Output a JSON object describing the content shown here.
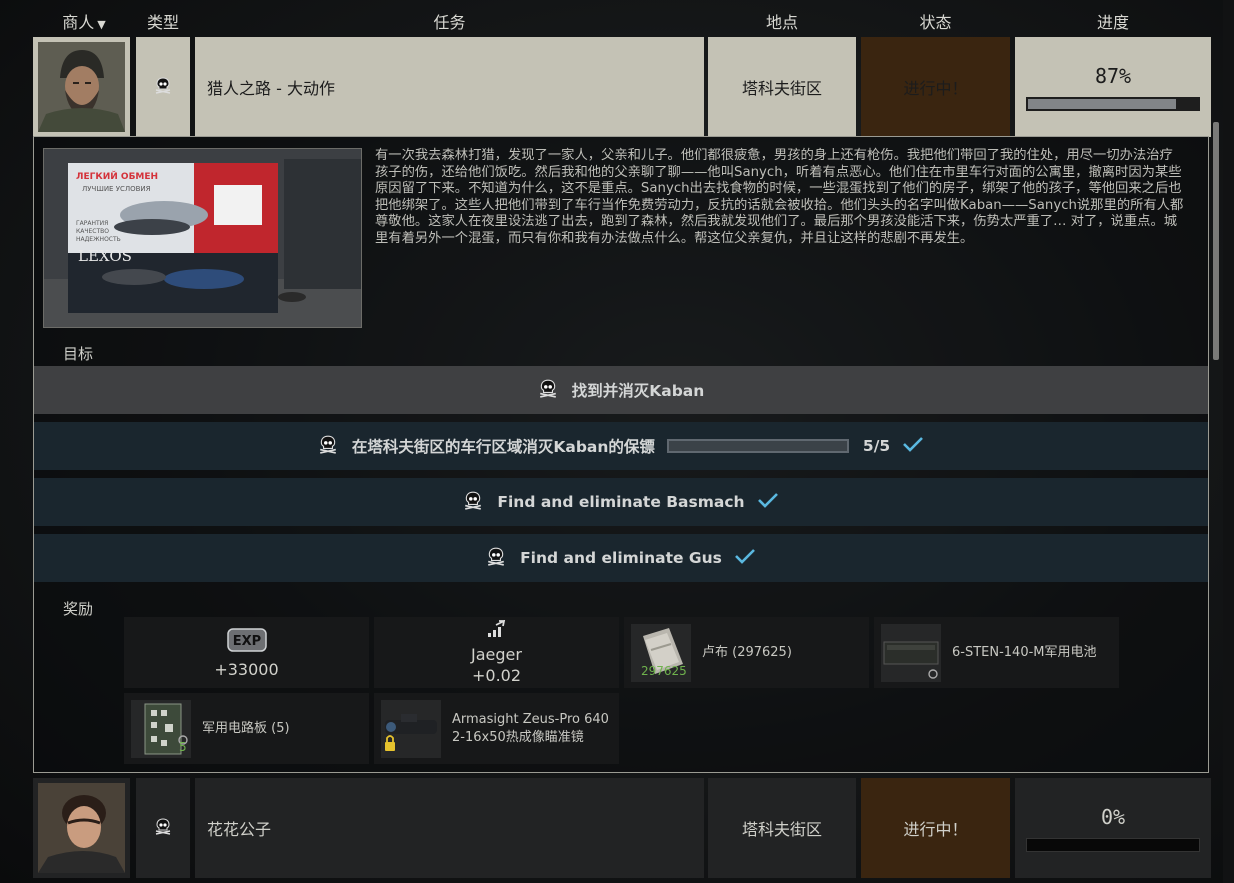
{
  "header": {
    "trader": "商人",
    "type": "类型",
    "task": "任务",
    "location": "地点",
    "status": "状态",
    "progress": "进度"
  },
  "quest1": {
    "name": "猎人之路 - 大动作",
    "location": "塔科夫街区",
    "status": "进行中！",
    "progress_text": "87%",
    "progress_fraction": 0.87,
    "type_icon": "skull-icon",
    "picture": {
      "sign_title": "ЛЕГКИЙ ОБМЕН",
      "sign_sub": "ЛУЧШИЕ УСЛОВИЯ",
      "sign_l1": "ГАРАНТИЯ",
      "sign_l2": "КАЧЕСТВО",
      "sign_l3": "НАДЕЖНОСТЬ",
      "brand": "LEXOS"
    },
    "description": "有一次我去森林打猎，发现了一家人，父亲和儿子。他们都很疲惫，男孩的身上还有枪伤。我把他们带回了我的住处，用尽一切办法治疗孩子的伤，还给他们饭吃。然后我和他的父亲聊了聊——他叫Sanych，听着有点恶心。他们住在市里车行对面的公寓里，撤离时因为某些原因留了下来。不知道为什么，这不是重点。Sanych出去找食物的时候，一些混蛋找到了他们的房子，绑架了他的孩子，等他回来之后也把他绑架了。这些人把他们带到了车行当作免费劳动力，反抗的话就会被收拾。他们头头的名字叫做Kaban——Sanych说那里的所有人都尊敬他。这家人在夜里设法逃了出去，跑到了森林，然后我就发现他们了。最后那个男孩没能活下来，伤势太严重了… 对了，说重点。城里有着另外一个混蛋，而只有你和我有办法做点什么。帮这位父亲复仇，并且让这样的悲剧不再发生。",
    "objectives_label": "目标",
    "objectives": [
      {
        "text": "找到并消灭Kaban",
        "done": false
      },
      {
        "text": "在塔科夫街区的车行区域消灭Kaban的保镖",
        "count": "5/5",
        "fraction": 1.0,
        "done": true
      },
      {
        "text": "Find and eliminate Basmach",
        "done": true
      },
      {
        "text": "Find and eliminate Gus",
        "done": true
      }
    ],
    "rewards_label": "奖励",
    "rewards": {
      "exp_badge": "EXP",
      "exp_value": "+33000",
      "trader_name": "Jaeger",
      "trader_value": "+0.02",
      "item1": "卢布 (297625)",
      "item1_count": "297625",
      "item2": "6-STEN-140-M军用电池",
      "item3": "军用电路板 (5)",
      "item3_count": "5",
      "item4_line1": "Armasight Zeus-Pro 640",
      "item4_line2": "2-16x50热成像瞄准镜"
    }
  },
  "quest2": {
    "name": "花花公子",
    "location": "塔科夫街区",
    "status": "进行中！",
    "progress_text": "0%",
    "progress_fraction": 0.0,
    "type_icon": "skull-icon"
  },
  "colors": {
    "status_orange": "#e08a29",
    "check_blue": "#5ab8e0",
    "objective_blue": "#1a262e"
  }
}
